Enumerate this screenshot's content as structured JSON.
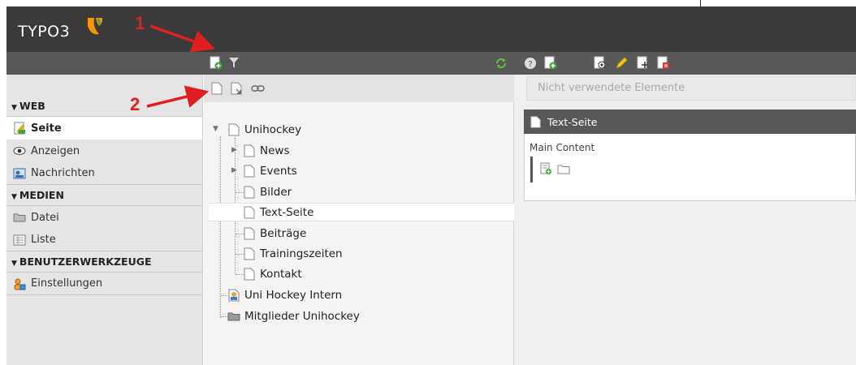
{
  "app": {
    "logo_text": "TYPO3"
  },
  "annotations": {
    "one": "1",
    "two": "2"
  },
  "module_menu": {
    "sections": [
      {
        "title": "WEB",
        "items": [
          {
            "label": "Seite",
            "icon": "page-module-icon",
            "active": true
          },
          {
            "label": "Anzeigen",
            "icon": "view-eye-icon"
          },
          {
            "label": "Nachrichten",
            "icon": "news-icon"
          }
        ]
      },
      {
        "title": "MEDIEN",
        "items": [
          {
            "label": "Datei",
            "icon": "folder-icon"
          },
          {
            "label": "Liste",
            "icon": "list-icon"
          }
        ]
      },
      {
        "title": "BENUTZERWERKZEUGE",
        "items": [
          {
            "label": "Einstellungen",
            "icon": "user-settings-icon"
          }
        ]
      }
    ]
  },
  "tree": {
    "root": "Unihockey",
    "children": [
      "News",
      "Events",
      "Bilder",
      "Text-Seite",
      "Beiträge",
      "Trainingszeiten",
      "Kontakt"
    ],
    "selected": "Text-Seite",
    "extra": [
      "Uni Hockey Intern",
      "Mitglieder Unihockey"
    ]
  },
  "content": {
    "unused_placeholder": "Nicht verwendete Elemente",
    "panel_title": "Text-Seite",
    "column_label": "Main Content"
  },
  "colors": {
    "topbar": "#3a3a3a",
    "toolbar": "#585858",
    "annotation": "#e02020",
    "typo3_orange": "#f49700"
  }
}
